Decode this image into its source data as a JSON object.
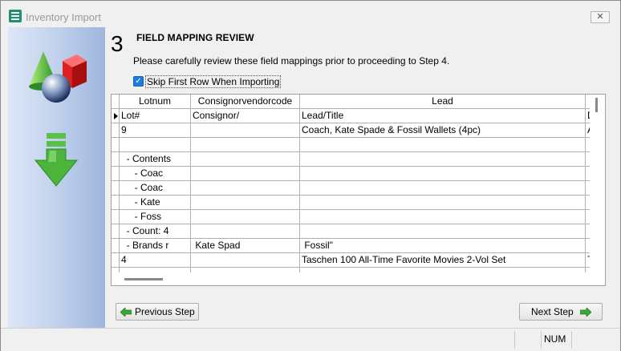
{
  "window": {
    "title": "Inventory Import",
    "close_label": "✕"
  },
  "step": {
    "number": "3",
    "title": "FIELD MAPPING REVIEW",
    "instructions": "Please carefully review these field mappings prior to proceeding to Step 4.",
    "skip_first_row": {
      "label": "Skip First Row When Importing",
      "checked": true
    }
  },
  "grid": {
    "columns": [
      "Lotnum",
      "Consignorvendorcode",
      "Lead",
      "D"
    ],
    "rows": [
      [
        "Lot#",
        "Consignor/",
        "Lead/Title",
        "D"
      ],
      [
        "9",
        "",
        "Coach, Kate Spade & Fossil Wallets (4pc)",
        "A"
      ],
      [
        "",
        "",
        "",
        ""
      ],
      [
        "  - Contents",
        "",
        "",
        ""
      ],
      [
        "     - Coac",
        "",
        "",
        ""
      ],
      [
        "     - Coac",
        "",
        "",
        ""
      ],
      [
        "     - Kate",
        "",
        "",
        ""
      ],
      [
        "     - Foss",
        "",
        "",
        ""
      ],
      [
        "  - Count: 4",
        "",
        "",
        ""
      ],
      [
        "  - Brands r",
        " Kate Spad",
        " Fossil\"",
        ""
      ],
      [
        "4",
        "",
        "Taschen 100 All-Time Favorite Movies 2-Vol Set",
        "T"
      ],
      [
        "",
        "",
        "",
        ""
      ]
    ]
  },
  "buttons": {
    "previous": "Previous Step",
    "next": "Next Step"
  },
  "statusbar": {
    "num": "NUM"
  }
}
